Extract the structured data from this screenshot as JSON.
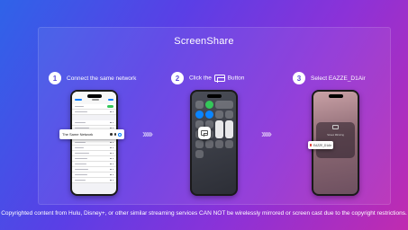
{
  "title": "ScreenShare",
  "steps": [
    {
      "number": "1",
      "label": "Connect the same network"
    },
    {
      "number": "2",
      "label_before": "Click the",
      "label_after": "Button"
    },
    {
      "number": "3",
      "label": "Select EAZZE_D1Air"
    }
  ],
  "phone1": {
    "highlighted_network": "The Same Network",
    "icon": "wifi-settings"
  },
  "phone2": {
    "highlight_icon": "screen-mirroring-icon"
  },
  "phone3": {
    "panel_title": "Screen Mirroring",
    "device": "EAZZE_D1Air"
  },
  "arrows": "›››››",
  "footer": "Copyrighted content from Hulu, Disney+, or other similar streaming services CAN NOT be wirelessly mirrored or screen cast due to the copyright restrictions.",
  "colors": {
    "bg_start": "#2f63e8",
    "bg_end": "#c02bb0",
    "step_number_text": "#5b49d8",
    "toggle_green": "#34c759"
  }
}
